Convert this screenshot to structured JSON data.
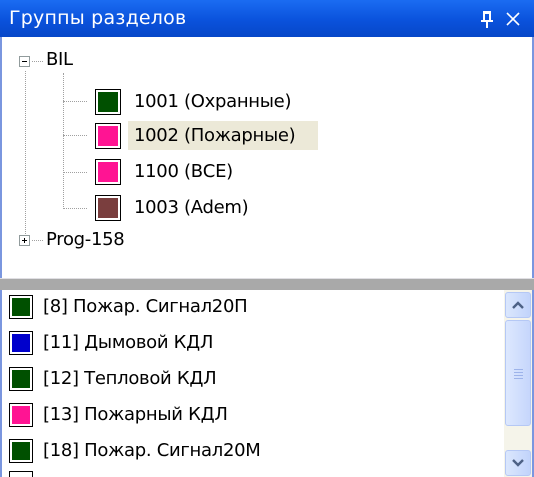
{
  "panel": {
    "title": "Группы разделов"
  },
  "colors": {
    "title_bar": "#0a52dc",
    "green": "#005000",
    "pink": "#ff1493",
    "brown": "#7a3e3e",
    "blue": "#0000cc",
    "selection": "#ece9d8"
  },
  "icons": {
    "pin": "pin-icon",
    "close": "close-icon",
    "collapse": "minus-box-icon",
    "expand": "plus-box-icon"
  },
  "tree": {
    "groups": [
      {
        "label": "BIL",
        "expanded": true,
        "children": [
          {
            "label": "1001 (Охранные)",
            "color": "#005000",
            "selected": false
          },
          {
            "label": "1002 (Пожарные)",
            "color": "#ff1493",
            "selected": true
          },
          {
            "label": "1100 (ВСЕ)",
            "color": "#ff1493",
            "selected": false
          },
          {
            "label": "1003 (Adem)",
            "color": "#7a3e3e",
            "selected": false
          }
        ]
      },
      {
        "label": "Prog-158",
        "expanded": false,
        "children": []
      }
    ]
  },
  "zones": {
    "items": [
      {
        "label": "[8] Пожар. Сигнал20П",
        "color": "#005000"
      },
      {
        "label": "[11] Дымовой КДЛ",
        "color": "#0000cc"
      },
      {
        "label": "[12] Тепловой КДЛ",
        "color": "#005000"
      },
      {
        "label": "[13] Пожарный КДЛ",
        "color": "#ff1493"
      },
      {
        "label": "[18] Пожар. Сигнал20М",
        "color": "#005000"
      }
    ]
  }
}
